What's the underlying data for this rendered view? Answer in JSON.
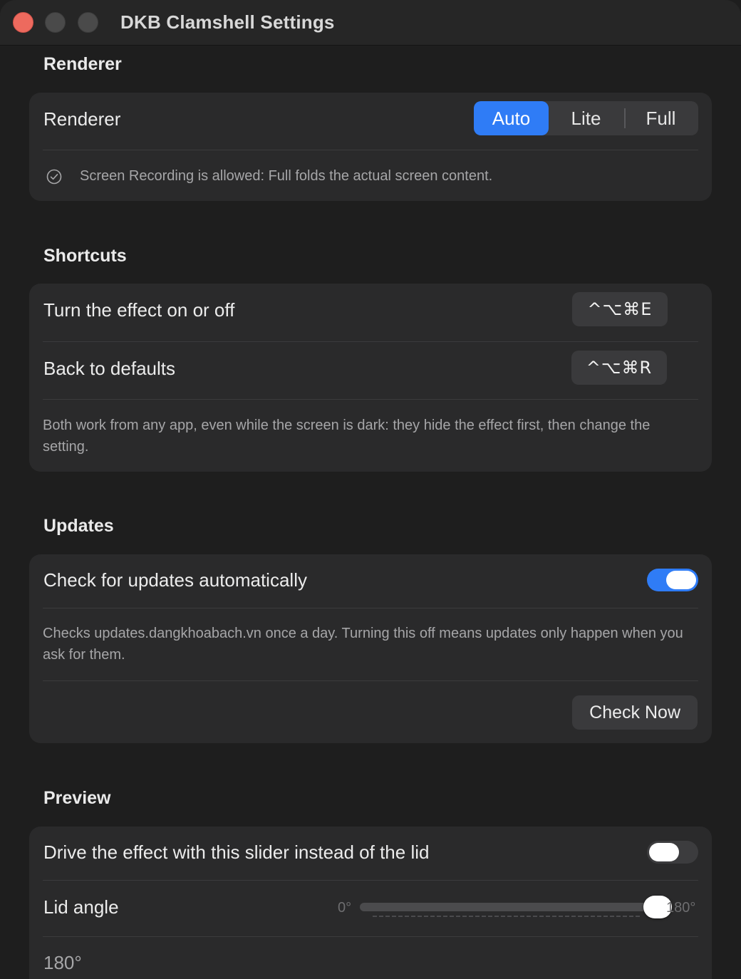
{
  "window": {
    "title": "DKB Clamshell Settings"
  },
  "renderer": {
    "section_title": "Renderer",
    "row_label": "Renderer",
    "options": [
      "Auto",
      "Lite",
      "Full"
    ],
    "selected": "Auto",
    "status_icon": "checkmark-circle-icon",
    "status_text": "Screen Recording is allowed: Full folds the actual screen content."
  },
  "shortcuts": {
    "section_title": "Shortcuts",
    "items": [
      {
        "label": "Turn the effect on or off",
        "keys": "^⌥⌘E"
      },
      {
        "label": "Back to defaults",
        "keys": "^⌥⌘R"
      }
    ],
    "note": "Both work from any app, even while the screen is dark: they hide the effect first, then change the setting."
  },
  "updates": {
    "section_title": "Updates",
    "auto_check_label": "Check for updates automatically",
    "auto_check_enabled": true,
    "note": "Checks updates.dangkhoabach.vn once a day. Turning this off means updates only happen when you ask for them.",
    "check_now_label": "Check Now"
  },
  "preview": {
    "section_title": "Preview",
    "drive_slider_label": "Drive the effect with this slider instead of the lid",
    "drive_slider_enabled": false,
    "lid_angle_label": "Lid angle",
    "slider_min_label": "0°",
    "slider_max_label": "180°",
    "lid_angle_value": 180,
    "lid_angle_max": 180,
    "lid_angle_readout": "180°"
  },
  "colors": {
    "accent": "#2f7cf6",
    "close_button": "#ed6a5e",
    "background": "#1e1e1e",
    "card": "#2a2a2b"
  }
}
